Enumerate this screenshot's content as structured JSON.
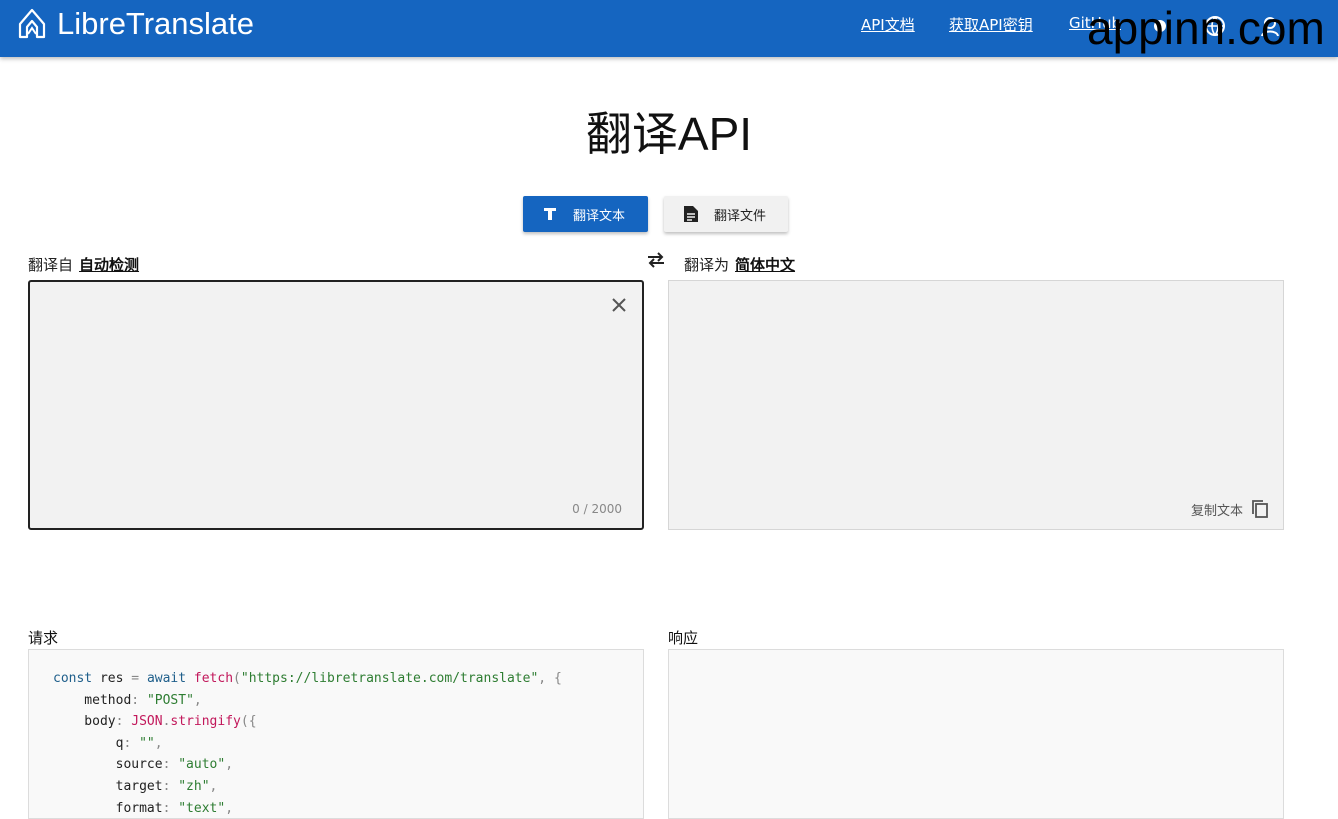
{
  "navbar": {
    "brand_title": "LibreTranslate",
    "links": [
      {
        "label": "API文档"
      },
      {
        "label": "获取API密钥"
      },
      {
        "label": "GitHub"
      }
    ],
    "watermark": "appinn.com",
    "icons": [
      "theme-toggle-icon",
      "language-icon",
      "account-icon"
    ]
  },
  "page": {
    "title": "翻译API"
  },
  "modes": {
    "text_label": "翻译文本",
    "file_label": "翻译文件"
  },
  "source": {
    "label": "翻译自",
    "language": "自动检测",
    "value": "",
    "char_count": "0 / 2000"
  },
  "target": {
    "label": "翻译为",
    "language": "简体中文",
    "copy_label": "复制文本"
  },
  "request": {
    "label": "请求",
    "code_lines": [
      "const res = await fetch(\"https://libretranslate.com/translate\", {",
      "    method: \"POST\",",
      "    body: JSON.stringify({",
      "        q: \"\",",
      "        source: \"auto\",",
      "        target: \"zh\",",
      "        format: \"text\","
    ]
  },
  "response": {
    "label": "响应"
  },
  "colors": {
    "primary": "#1565c0",
    "panel": "#f2f2f2"
  }
}
